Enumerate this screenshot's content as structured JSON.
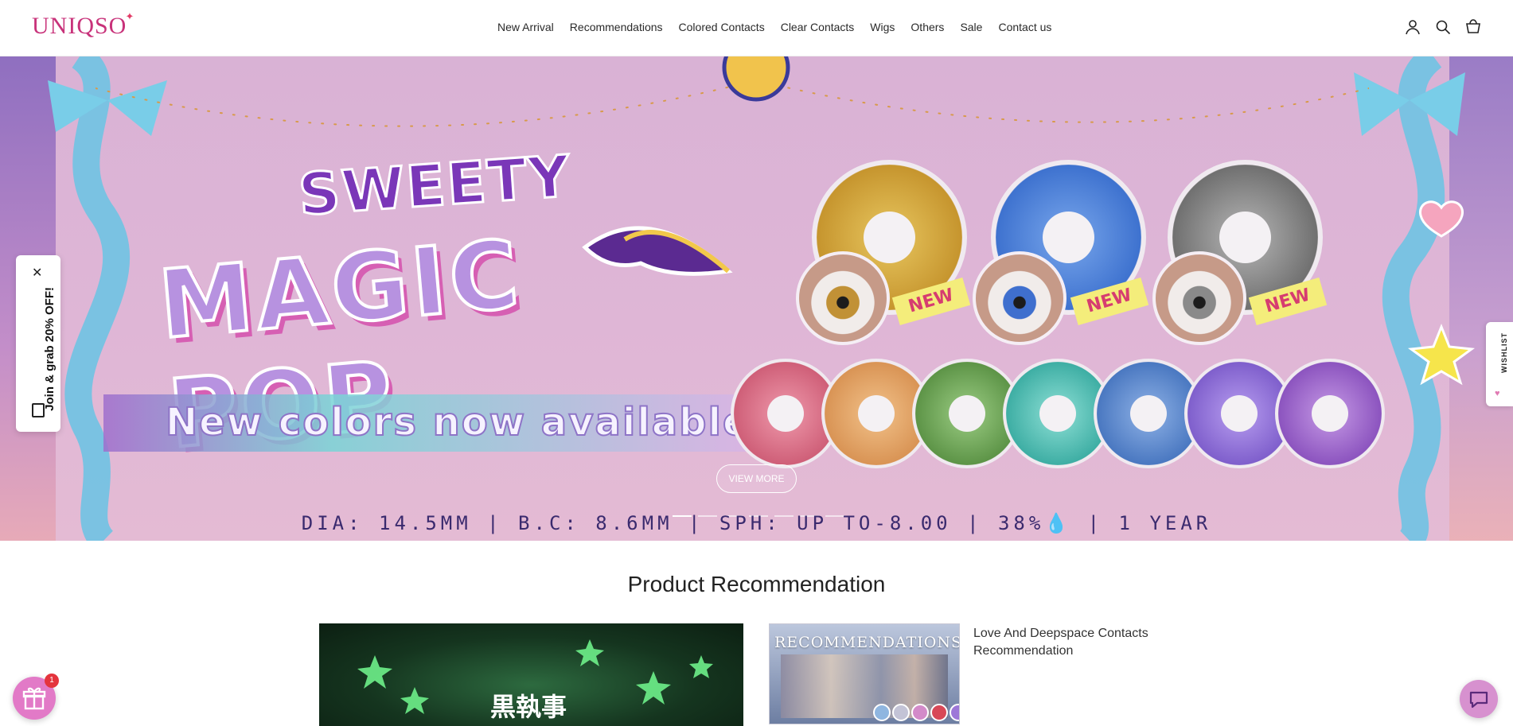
{
  "header": {
    "logo": "UNIQSO",
    "nav": [
      "New Arrival",
      "Recommendations",
      "Colored Contacts",
      "Clear Contacts",
      "Wigs",
      "Others",
      "Sale",
      "Contact us"
    ],
    "icons": [
      "account-icon",
      "search-icon",
      "cart-icon"
    ]
  },
  "hero": {
    "title_top": "SWEETY",
    "title_main": "MAGIC POP",
    "new_label": "NEW",
    "banner": "New colors now available!",
    "button": "VIEW MORE",
    "specs": "DIA: 14.5MM  |  B.C: 8.6MM  |  SPH: UP TO-8.00  |  38%💧  |  1 YEAR",
    "lens_colors": [
      "#d6aa3e",
      "#4f8ad8",
      "#8d8d8d",
      "#d86a86",
      "#e3a96d",
      "#6fa65a",
      "#4fbdb5",
      "#5b86c9",
      "#8c6bd1",
      "#9b63c6"
    ],
    "eye_colors": [
      "#c19136",
      "#3f6fce",
      "#8a8a8a"
    ]
  },
  "popups": {
    "join": "Join & grab 20% OFF!",
    "close": "✕",
    "wishlist": "WISHLIST"
  },
  "section": {
    "title": "Product Recommendation"
  },
  "cards": {
    "big_brand": "黒執事",
    "small_title": "RECOMMENDATIONS",
    "small_desc": "Love And Deepspace Contacts Recommendation",
    "small_lens_colors": [
      "#8fb6e0",
      "#c3c3d6",
      "#d38ac9",
      "#d84857",
      "#9d77d8"
    ]
  },
  "widgets": {
    "gift_count": "1"
  }
}
